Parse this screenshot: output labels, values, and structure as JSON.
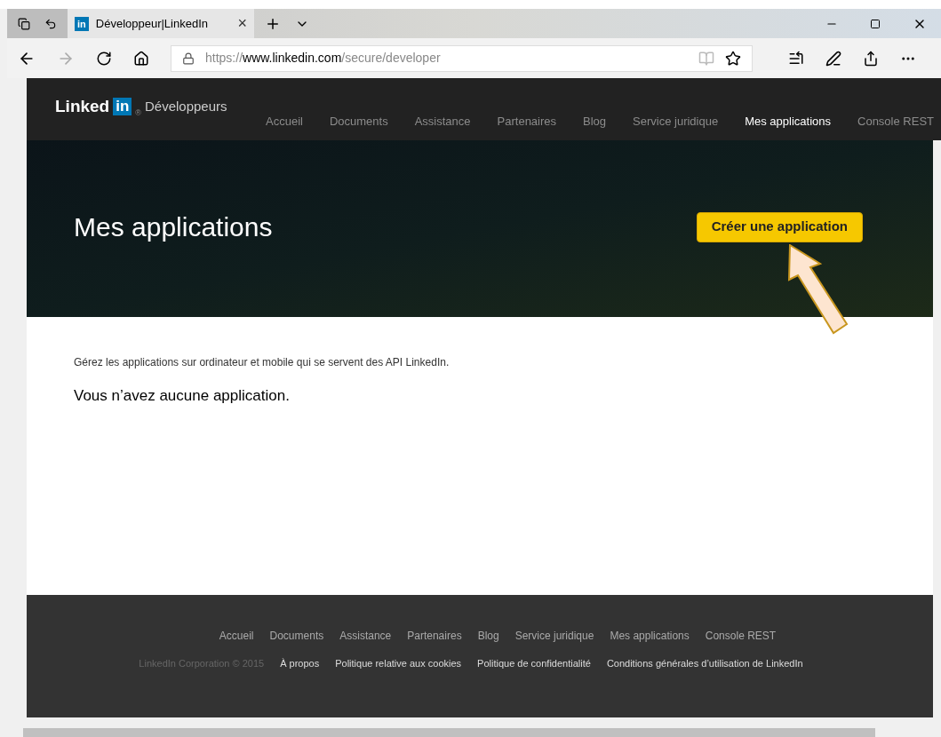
{
  "browser": {
    "tab": {
      "favicon": "in",
      "title": "Développeur|LinkedIn",
      "close": "×"
    },
    "url": {
      "scheme": "https://",
      "host": "www.linkedin.com",
      "path": "/secure/developer"
    }
  },
  "header": {
    "logo": {
      "word": "Linked",
      "badge": "in",
      "mark": "®",
      "product": "Développeurs"
    },
    "nav": [
      {
        "label": "Accueil",
        "selected": false
      },
      {
        "label": "Documents",
        "selected": false
      },
      {
        "label": "Assistance",
        "selected": false
      },
      {
        "label": "Partenaires",
        "selected": false
      },
      {
        "label": "Blog",
        "selected": false
      },
      {
        "label": "Service juridique",
        "selected": false
      },
      {
        "label": "Mes applications",
        "selected": true
      },
      {
        "label": "Console REST",
        "selected": false
      }
    ]
  },
  "hero": {
    "title": "Mes applications",
    "button": "Créer une application"
  },
  "content": {
    "description": "Gérez les applications sur ordinateur et mobile qui se servent des API LinkedIn.",
    "empty_message": "Vous n’avez aucune application."
  },
  "footer": {
    "nav": [
      "Accueil",
      "Documents",
      "Assistance",
      "Partenaires",
      "Blog",
      "Service juridique",
      "Mes applications",
      "Console REST"
    ],
    "copyright": "LinkedIn Corporation © 2015",
    "links": [
      "À propos",
      "Politique relative aux cookies",
      "Politique de confidentialité",
      "Conditions générales d’utilisation de LinkedIn"
    ]
  }
}
